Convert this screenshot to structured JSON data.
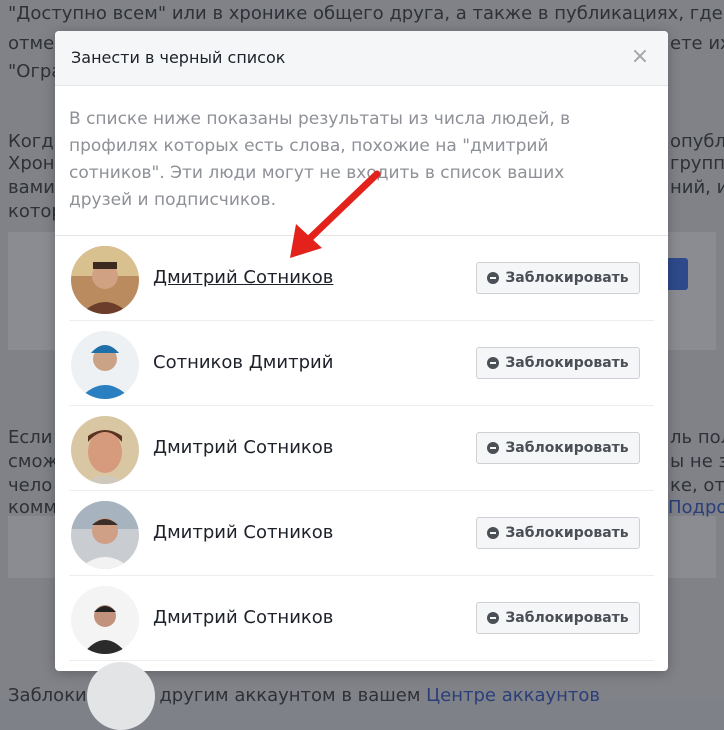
{
  "background": {
    "lines": [
      "\"Доступно всем\" или в хронике общего друга, а также в публикациях, где это",
      "отме",
      "\"Огра",
      "Когда",
      "Хрон",
      "вами",
      "котор",
      "Если",
      "смож",
      "чело",
      "комм"
    ],
    "right_fragments": [
      "ете их",
      "опубл",
      "группы",
      "ний, и",
      "ль пол",
      "ы не з",
      "ке, отм",
      "Подроб"
    ],
    "footer_text": "Заблокировано другим аккаунтом в вашем ",
    "footer_link": "Центре аккаунтов"
  },
  "dialog": {
    "title": "Занести в черный список",
    "close_label": "×",
    "description": "В списке ниже показаны результаты из числа людей, в профилях которых есть слова, похожие на \"дмитрий сотников\". Эти люди могут не входить в список ваших друзей и подписчиков.",
    "people": [
      {
        "name": "Дмитрий Сотников",
        "button": "Заблокировать"
      },
      {
        "name": "Сотников Дмитрий",
        "button": "Заблокировать"
      },
      {
        "name": "Дмитрий Сотников",
        "button": "Заблокировать"
      },
      {
        "name": "Дмитрий Сотников",
        "button": "Заблокировать"
      },
      {
        "name": "Дмитрий Сотников",
        "button": "Заблокировать"
      }
    ]
  },
  "colors": {
    "overlay": "#808288",
    "button_bg": "#f5f6f7",
    "arrow": "#e3221c"
  }
}
